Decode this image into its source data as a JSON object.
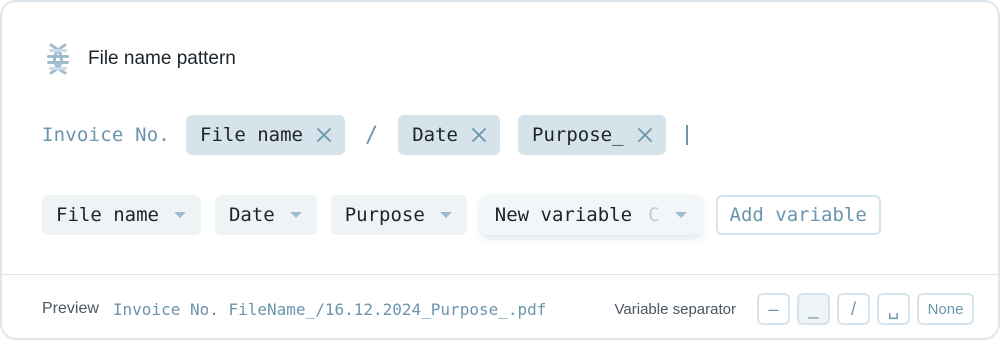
{
  "header": {
    "title": "File name pattern",
    "icon": "dna-icon"
  },
  "pattern": {
    "prefix": "Invoice No.",
    "chips": [
      {
        "label": "File name"
      },
      {
        "label": "Date"
      },
      {
        "label": "Purpose_"
      }
    ],
    "separator": "/"
  },
  "variables": {
    "items": [
      {
        "label": "File name"
      },
      {
        "label": "Date"
      },
      {
        "label": "Purpose"
      }
    ],
    "new_variable": {
      "value": "New variable",
      "hint": "C"
    },
    "add_label": "Add variable"
  },
  "footer": {
    "preview_label": "Preview",
    "preview_value": "Invoice No. FileName_/16.12.2024_Purpose_.pdf",
    "separator_label": "Variable separator",
    "separators": [
      {
        "symbol": "–"
      },
      {
        "symbol": "_"
      },
      {
        "symbol": "/"
      },
      {
        "symbol": "␣"
      },
      {
        "symbol": "None"
      }
    ]
  },
  "colors": {
    "accent": "#6b95ad",
    "chip_bg": "#d6e3ea",
    "var_bg": "#eef3f6",
    "border": "#dde6ec"
  }
}
